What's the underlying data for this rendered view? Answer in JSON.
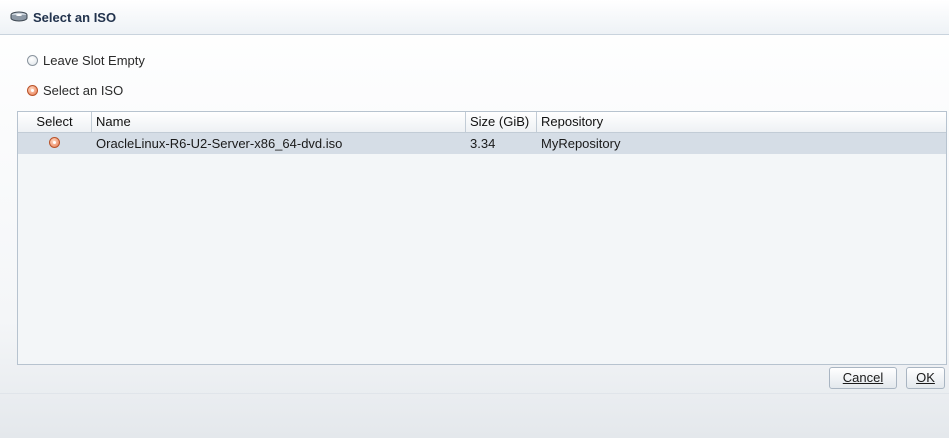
{
  "dialog": {
    "title": "Select an ISO",
    "title_icon": "disc-drive-icon"
  },
  "options": {
    "leave_empty_label": "Leave Slot Empty",
    "select_iso_label": "Select an ISO",
    "selected": "select_iso"
  },
  "table": {
    "columns": [
      "Select",
      "Name",
      "Size (GiB)",
      "Repository"
    ],
    "rows": [
      {
        "selected": true,
        "name": "OracleLinux-R6-U2-Server-x86_64-dvd.iso",
        "size": "3.34",
        "repository": "MyRepository"
      }
    ]
  },
  "buttons": {
    "cancel_label": "Cancel",
    "ok_label": "OK"
  },
  "colors": {
    "accent": "#e8764a",
    "selected_row": "#d5dde6",
    "title_text": "#22334d"
  }
}
